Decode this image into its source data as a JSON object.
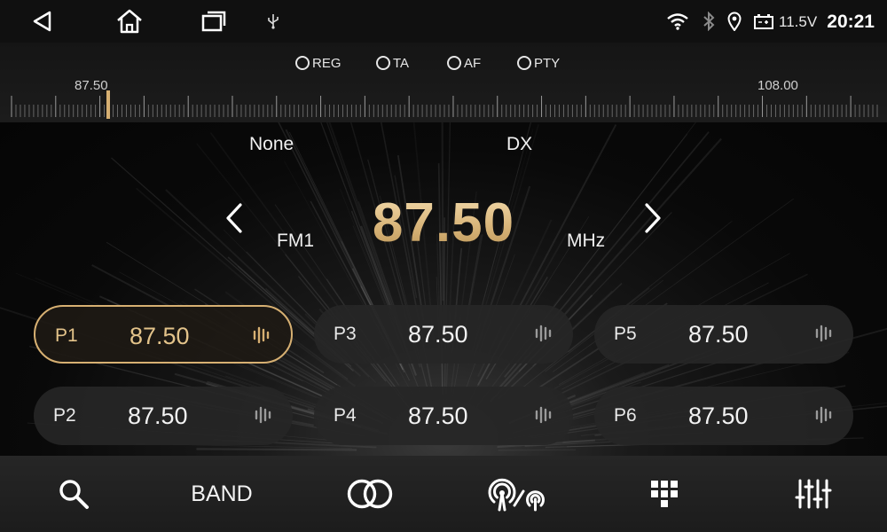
{
  "status_bar": {
    "voltage": "11.5V",
    "time": "20:21",
    "icons": [
      "back-icon",
      "home-icon",
      "recent-apps-icon",
      "usb-icon",
      "wifi-icon",
      "bluetooth-icon",
      "location-icon",
      "battery-icon"
    ]
  },
  "options": {
    "reg": "REG",
    "ta": "TA",
    "af": "AF",
    "pty": "PTY"
  },
  "scale": {
    "min_label": "87.50",
    "max_label": "108.00",
    "min": 87.5,
    "max": 108.0,
    "current": 87.5
  },
  "tuner": {
    "pty_name": "None",
    "mode": "DX",
    "band": "FM1",
    "frequency": "87.50",
    "unit": "MHz"
  },
  "presets": [
    {
      "label": "P1",
      "freq": "87.50",
      "active": true
    },
    {
      "label": "P2",
      "freq": "87.50",
      "active": false
    },
    {
      "label": "P3",
      "freq": "87.50",
      "active": false
    },
    {
      "label": "P4",
      "freq": "87.50",
      "active": false
    },
    {
      "label": "P5",
      "freq": "87.50",
      "active": false
    },
    {
      "label": "P6",
      "freq": "87.50",
      "active": false
    }
  ],
  "bottom_bar": {
    "band_label": "BAND",
    "icons": [
      "search-icon",
      "stereo-icon",
      "local-distance-icon",
      "grid-icon",
      "equalizer-icon"
    ]
  },
  "colors": {
    "accent": "#d7b072",
    "background": "#060606"
  }
}
